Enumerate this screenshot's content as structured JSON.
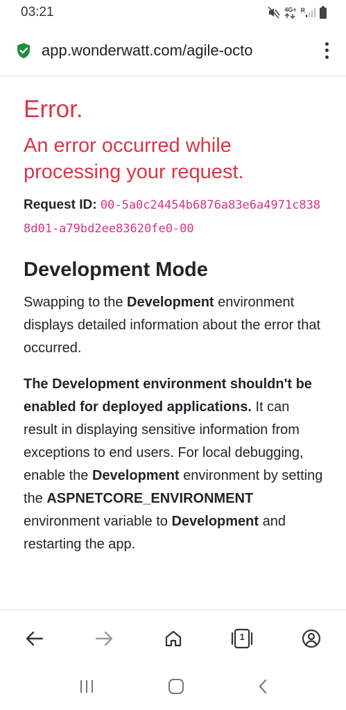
{
  "status": {
    "time": "03:21",
    "network": "4G+",
    "roaming": "R"
  },
  "browser": {
    "url": "app.wonderwatt.com/agile-octo",
    "tab_count": "1"
  },
  "page": {
    "title": "Error.",
    "subtitle": "An error occurred while processing your request.",
    "request_label": "Request ID:",
    "request_id": "00-5a0c24454b6876a83e6a4971c8388d01-a79bd2ee83620fe0-00",
    "dev_heading": "Development Mode",
    "para1": {
      "t1": "Swapping to the ",
      "b1": "Development",
      "t2": " environment displays detailed information about the error that occurred."
    },
    "para2": {
      "b1": "The Development environment shouldn't be enabled for deployed applications.",
      "t1": " It can result in displaying sensitive information from exceptions to end users. For local debugging, enable the ",
      "b2": "Development",
      "t2": " environment by setting the ",
      "b3": "ASPNETCORE_ENVIRONMENT",
      "t3": " environment variable to ",
      "b4": "Development",
      "t4": " and restarting the app."
    }
  },
  "colors": {
    "error": "#dc3545",
    "code": "#d63384",
    "lock": "#1e8e3e"
  }
}
